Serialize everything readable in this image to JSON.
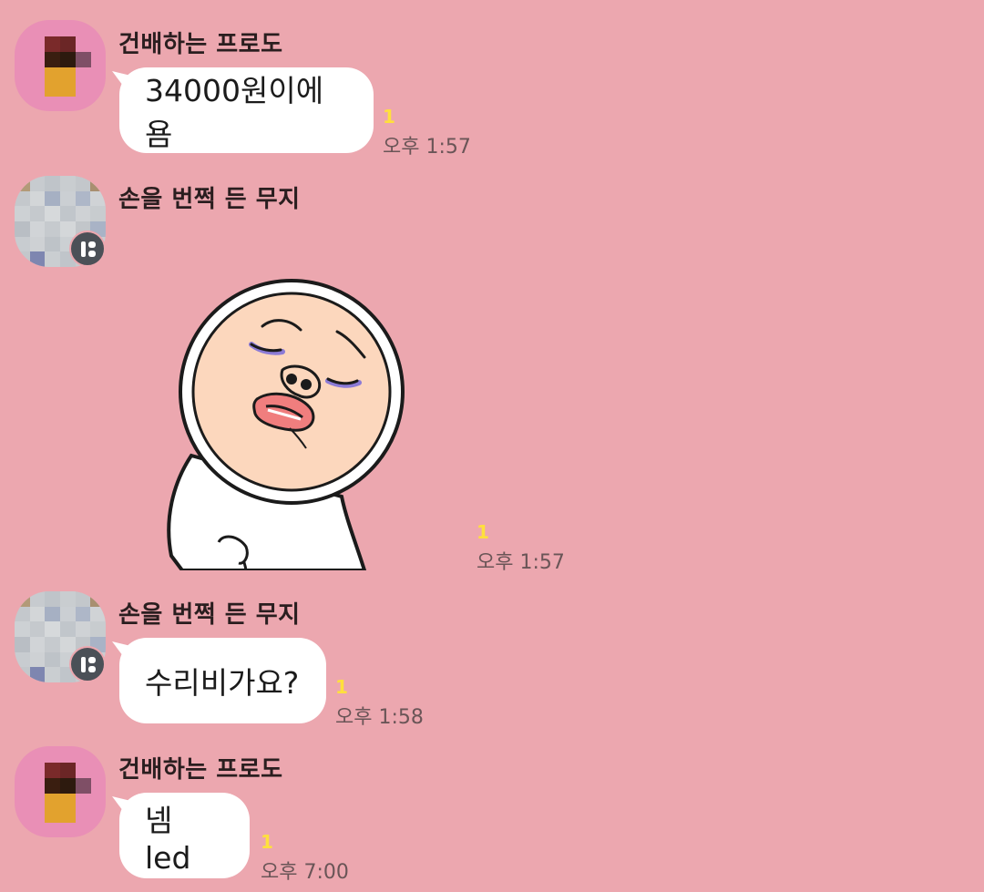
{
  "messages": [
    {
      "sender": "건배하는 프로도",
      "text": "34000원이에욤",
      "unread": "1",
      "time": "오후 1:57"
    },
    {
      "sender": "손을 번쩍 든 무지",
      "sticker": "muzi-sticker",
      "unread": "1",
      "time": "오후 1:57"
    },
    {
      "sender": "손을 번쩍 든 무지",
      "text": "수리비가요?",
      "unread": "1",
      "time": "오후 1:58"
    },
    {
      "sender": "건배하는 프로도",
      "text": "넴 led",
      "unread": "1",
      "time": "오후 7:00"
    }
  ],
  "colors": {
    "background": "#ECA7AF",
    "bubble": "#FFFFFF",
    "unread": "#FFE03C",
    "badge": "#4B5057"
  }
}
